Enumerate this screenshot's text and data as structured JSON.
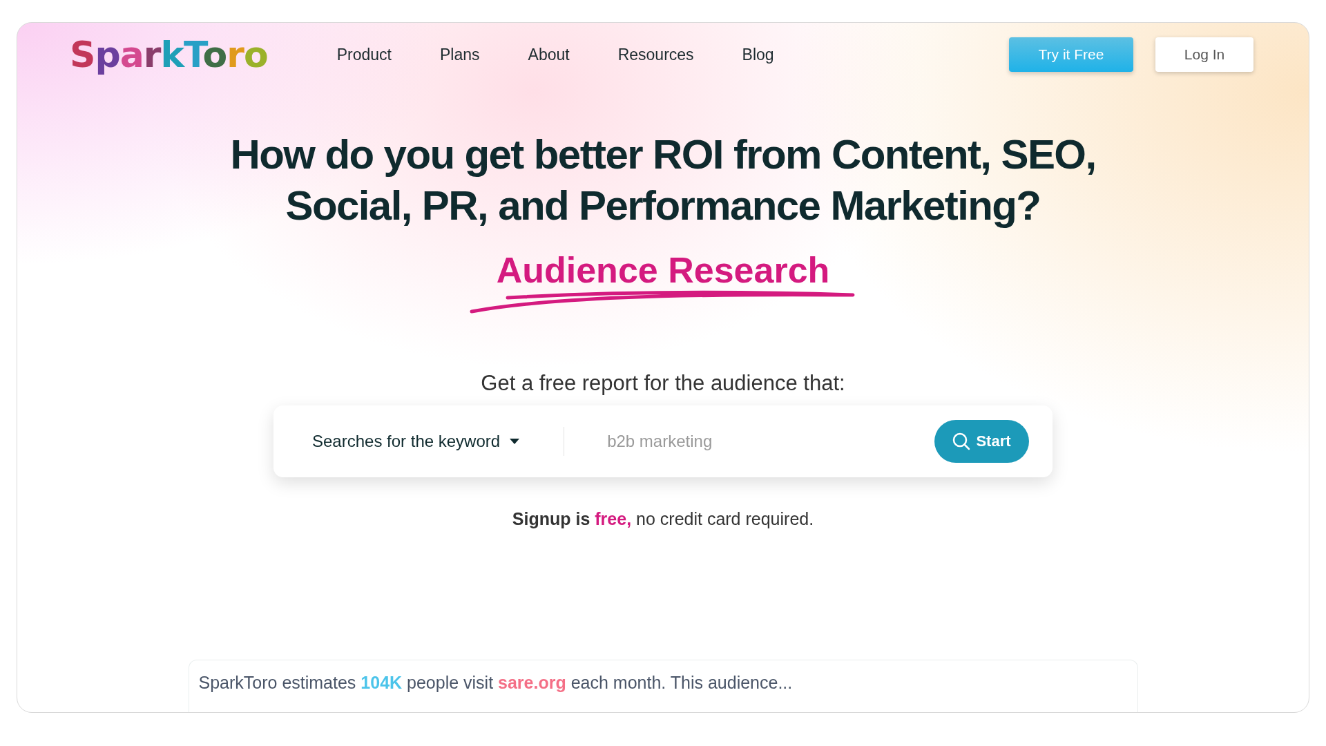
{
  "logo": {
    "text": "SparkToro"
  },
  "nav": {
    "items": [
      {
        "label": "Product"
      },
      {
        "label": "Plans"
      },
      {
        "label": "About"
      },
      {
        "label": "Resources"
      },
      {
        "label": "Blog"
      }
    ],
    "buttons": [
      {
        "kind": "primary",
        "label": "Try it Free"
      },
      {
        "kind": "secondary",
        "label": "Log In"
      }
    ]
  },
  "hero": {
    "headline": [
      "How do you get better ROI from Content, SEO,",
      "Social, PR, and Performance Marketing?"
    ],
    "highlight": "Audience Research",
    "prompt": "Get a free report for the audience that:",
    "search": {
      "mode": "Searches for the keyword",
      "placeholder": "b2b marketing",
      "button": "Start"
    },
    "note": [
      {
        "kind": "strong",
        "text": "Signup is "
      },
      {
        "kind": "accent",
        "text": "free,"
      },
      {
        "kind": "plain",
        "text": " no credit card required."
      }
    ]
  },
  "sample": {
    "segments": [
      {
        "kind": "plain",
        "text": "SparkToro estimates "
      },
      {
        "kind": "stat",
        "text": "104K"
      },
      {
        "kind": "plain",
        "text": " people visit "
      },
      {
        "kind": "site",
        "text": "sare.org"
      },
      {
        "kind": "plain",
        "text": " each month. This audience..."
      }
    ]
  }
}
